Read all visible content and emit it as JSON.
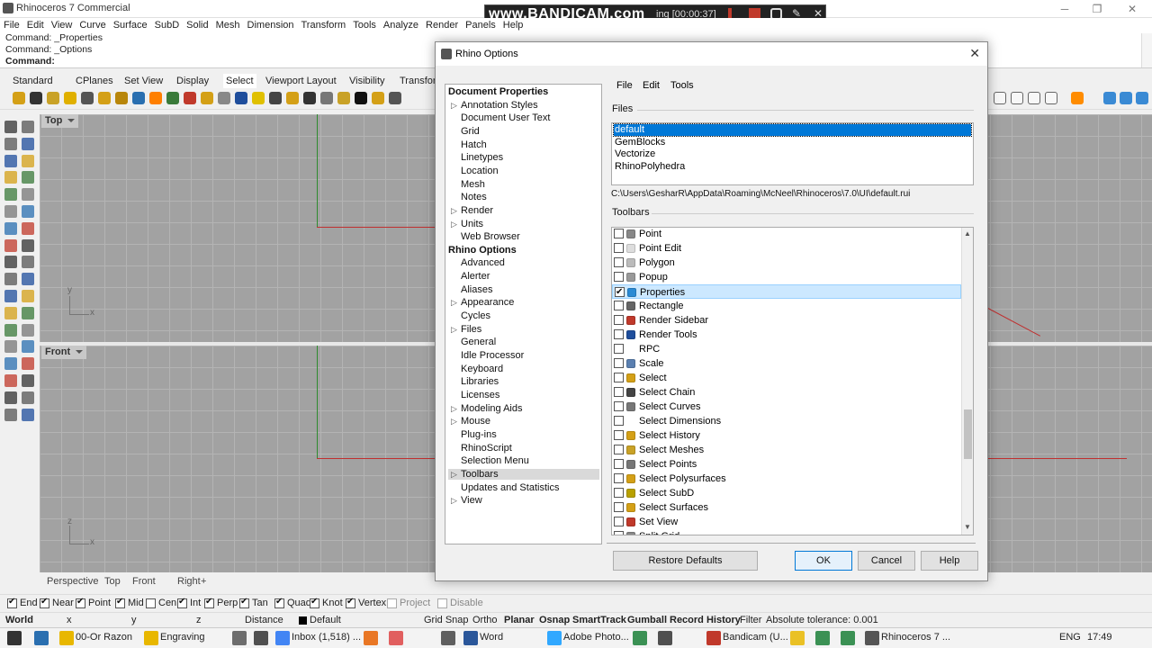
{
  "window": {
    "title": "Rhinoceros 7 Commercial",
    "min": "─",
    "max": "❐",
    "close": "✕"
  },
  "bandicam": {
    "logo": "www.BANDICAM.com",
    "status": "ing [00:00:37]"
  },
  "menubar": [
    "File",
    "Edit",
    "View",
    "Curve",
    "Surface",
    "SubD",
    "Solid",
    "Mesh",
    "Dimension",
    "Transform",
    "Tools",
    "Analyze",
    "Render",
    "Panels",
    "Help"
  ],
  "command": {
    "history": [
      "Command: _Properties",
      "Command: _Options"
    ],
    "prompt": "Command:"
  },
  "toolbar_tabs": [
    "Standard",
    "CPlanes",
    "Set View",
    "Display",
    "Select",
    "Viewport Layout",
    "Visibility",
    "Transform"
  ],
  "viewports": {
    "top": {
      "title": "Top",
      "axis_x": "x",
      "axis_y": "y"
    },
    "front": {
      "title": "Front",
      "axis_x": "x",
      "axis_y": "z"
    }
  },
  "viewport_tabs": [
    "Perspective",
    "Top",
    "Front",
    "Right",
    "+"
  ],
  "osnaps": [
    {
      "label": "End",
      "on": true
    },
    {
      "label": "Near",
      "on": true
    },
    {
      "label": "Point",
      "on": true
    },
    {
      "label": "Mid",
      "on": true
    },
    {
      "label": "Cen",
      "on": false
    },
    {
      "label": "Int",
      "on": true
    },
    {
      "label": "Perp",
      "on": true
    },
    {
      "label": "Tan",
      "on": true
    },
    {
      "label": "Quad",
      "on": true
    },
    {
      "label": "Knot",
      "on": true
    },
    {
      "label": "Vertex",
      "on": true
    },
    {
      "label": "Project",
      "on": false
    },
    {
      "label": "Disable",
      "on": false
    }
  ],
  "statusbar": {
    "world": "World",
    "x": "x",
    "y": "y",
    "z": "z",
    "distance": "Distance",
    "layer": "Default",
    "toggles": [
      "Grid Snap",
      "Ortho",
      "Planar",
      "Osnap",
      "SmartTrack",
      "Gumball",
      "Record History",
      "Filter"
    ],
    "tolerance": "Absolute tolerance: 0.001"
  },
  "taskbar": {
    "items": [
      "00-Or Razon",
      "Engraving",
      "Inbox (1,518) ...",
      "Word",
      "Adobe Photo...",
      "Bandicam (U...",
      "Rhinoceros 7 ..."
    ],
    "lang": "ENG",
    "time": "17:49"
  },
  "dialog": {
    "title": "Rhino Options",
    "close": "✕",
    "menu": [
      "File",
      "Edit",
      "Tools"
    ],
    "tree": [
      {
        "label": "Document Properties",
        "header": true
      },
      {
        "label": "Annotation Styles",
        "expand": true
      },
      {
        "label": "Document User Text"
      },
      {
        "label": "Grid"
      },
      {
        "label": "Hatch"
      },
      {
        "label": "Linetypes"
      },
      {
        "label": "Location"
      },
      {
        "label": "Mesh"
      },
      {
        "label": "Notes"
      },
      {
        "label": "Render",
        "expand": true
      },
      {
        "label": "Units",
        "expand": true
      },
      {
        "label": "Web Browser"
      },
      {
        "label": "Rhino Options",
        "header": true
      },
      {
        "label": "Advanced"
      },
      {
        "label": "Alerter"
      },
      {
        "label": "Aliases"
      },
      {
        "label": "Appearance",
        "expand": true
      },
      {
        "label": "Cycles"
      },
      {
        "label": "Files",
        "expand": true
      },
      {
        "label": "General"
      },
      {
        "label": "Idle Processor"
      },
      {
        "label": "Keyboard"
      },
      {
        "label": "Libraries"
      },
      {
        "label": "Licenses"
      },
      {
        "label": "Modeling Aids",
        "expand": true
      },
      {
        "label": "Mouse",
        "expand": true
      },
      {
        "label": "Plug-ins"
      },
      {
        "label": "RhinoScript"
      },
      {
        "label": "Selection Menu"
      },
      {
        "label": "Toolbars",
        "expand": true,
        "selected": true
      },
      {
        "label": "Updates and Statistics"
      },
      {
        "label": "View",
        "expand": true
      }
    ],
    "files_label": "Files",
    "files": [
      {
        "label": "default",
        "selected": true
      },
      {
        "label": "GemBlocks"
      },
      {
        "label": "Vectorize"
      },
      {
        "label": "RhinoPolyhedra"
      }
    ],
    "file_path": "C:\\Users\\GesharR\\AppData\\Roaming\\McNeel\\Rhinoceros\\7.0\\UI\\default.rui",
    "toolbars_label": "Toolbars",
    "toolbars": [
      {
        "label": "Point",
        "checked": false,
        "icon": "#888888"
      },
      {
        "label": "Point Edit",
        "checked": false,
        "icon": "#dddddd"
      },
      {
        "label": "Polygon",
        "checked": false,
        "icon": "#bbbbbb"
      },
      {
        "label": "Popup",
        "checked": false,
        "icon": "#999999"
      },
      {
        "label": "Properties",
        "checked": true,
        "selected": true,
        "icon": "#2a8ad4"
      },
      {
        "label": "Rectangle",
        "checked": false,
        "icon": "#666666"
      },
      {
        "label": "Render Sidebar",
        "checked": false,
        "icon": "#c0392b"
      },
      {
        "label": "Render Tools",
        "checked": false,
        "icon": "#1f4e9c"
      },
      {
        "label": "RPC",
        "checked": false,
        "icon": "#ffffff"
      },
      {
        "label": "Scale",
        "checked": false,
        "icon": "#5a7fb0"
      },
      {
        "label": "Select",
        "checked": false,
        "icon": "#d4a017"
      },
      {
        "label": "Select Chain",
        "checked": false,
        "icon": "#444444"
      },
      {
        "label": "Select Curves",
        "checked": false,
        "icon": "#777777"
      },
      {
        "label": "Select Dimensions",
        "checked": false,
        "icon": "#ffffff"
      },
      {
        "label": "Select History",
        "checked": false,
        "icon": "#d4a017"
      },
      {
        "label": "Select Meshes",
        "checked": false,
        "icon": "#c9a227"
      },
      {
        "label": "Select Points",
        "checked": false,
        "icon": "#777777"
      },
      {
        "label": "Select Polysurfaces",
        "checked": false,
        "icon": "#d4a017"
      },
      {
        "label": "Select SubD",
        "checked": false,
        "icon": "#b8a000"
      },
      {
        "label": "Select Surfaces",
        "checked": false,
        "icon": "#d4a017"
      },
      {
        "label": "Set View",
        "checked": false,
        "icon": "#c0392b"
      },
      {
        "label": "Split Grid",
        "checked": false,
        "icon": "#888888"
      }
    ],
    "buttons": {
      "restore": "Restore Defaults",
      "ok": "OK",
      "cancel": "Cancel",
      "help": "Help"
    }
  },
  "colors": {
    "accent": "#0078d7",
    "viewport": "#a2a2a2",
    "grid": "#b4b4b4",
    "axis_red": "#c03030",
    "axis_green": "#2e8b2e"
  }
}
